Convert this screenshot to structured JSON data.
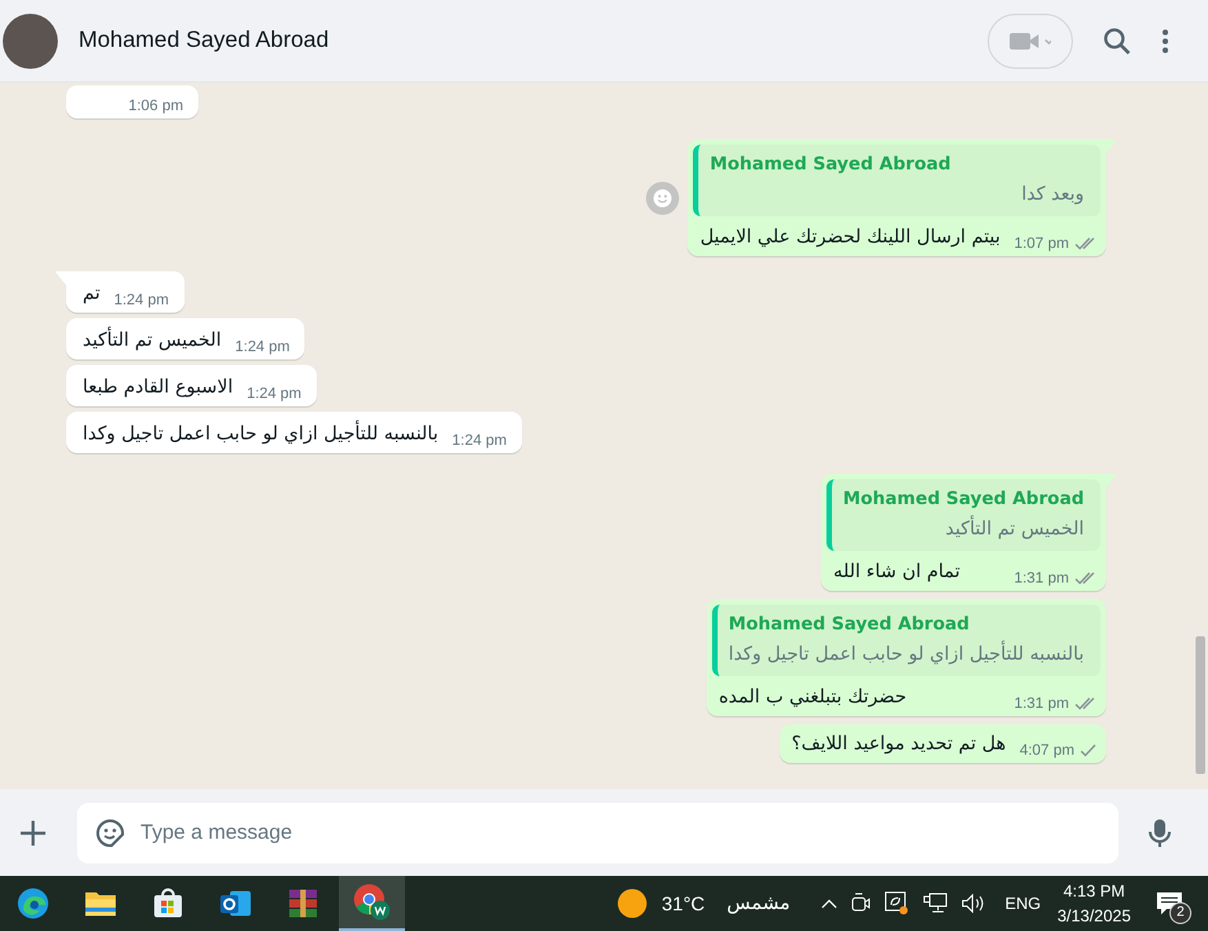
{
  "header": {
    "contact_name": "Mohamed Sayed Abroad"
  },
  "messages": [
    {
      "outgoing": false,
      "time": "1:06 pm",
      "group_start": false
    },
    {
      "outgoing": true,
      "group_start": true,
      "quote": {
        "author": "Mohamed Sayed Abroad",
        "text": "وبعد كدا"
      },
      "text": "بيتم ارسال اللينك لحضرتك علي الايميل",
      "time": "1:07 pm",
      "delivered": true,
      "reaction_button": true
    },
    {
      "outgoing": false,
      "group_start": true,
      "text": "تم",
      "time": "1:24 pm"
    },
    {
      "outgoing": false,
      "group_start": false,
      "text": "الخميس تم التأكيد",
      "time": "1:24 pm"
    },
    {
      "outgoing": false,
      "group_start": false,
      "text": "الاسبوع القادم طبعا",
      "time": "1:24 pm"
    },
    {
      "outgoing": false,
      "group_start": false,
      "text": "بالنسبه للتأجيل  ازاي لو حابب اعمل تاجيل وكدا",
      "time": "1:24 pm"
    },
    {
      "outgoing": true,
      "group_start": true,
      "quote": {
        "author": "Mohamed Sayed Abroad",
        "text": "الخميس تم التأكيد"
      },
      "text": "تمام ان شاء الله",
      "time": "1:31 pm",
      "delivered": true
    },
    {
      "outgoing": true,
      "group_start": false,
      "quote": {
        "author": "Mohamed Sayed Abroad",
        "text": "بالنسبه للتأجيل  ازاي لو حابب اعمل تاجيل وكدا"
      },
      "text": "حضرتك بتبلغني ب المده",
      "time": "1:31 pm",
      "delivered": true
    },
    {
      "outgoing": true,
      "group_start": false,
      "text": "هل تم تحديد مواعيد اللايف؟",
      "time": "4:07 pm",
      "delivered": false
    }
  ],
  "composer": {
    "placeholder": "Type a message"
  },
  "taskbar": {
    "apps": [
      {
        "kind": "edge",
        "selected": false
      },
      {
        "kind": "explorer",
        "selected": false
      },
      {
        "kind": "store",
        "selected": false
      },
      {
        "kind": "outlook",
        "selected": false
      },
      {
        "kind": "winrar",
        "selected": false
      },
      {
        "kind": "chrome",
        "selected": true
      }
    ],
    "weather": {
      "temperature": "31°C",
      "condition": "مشمس"
    },
    "language": "ENG",
    "time": "4:13 PM",
    "date": "3/13/2025",
    "notification_count": "2"
  }
}
